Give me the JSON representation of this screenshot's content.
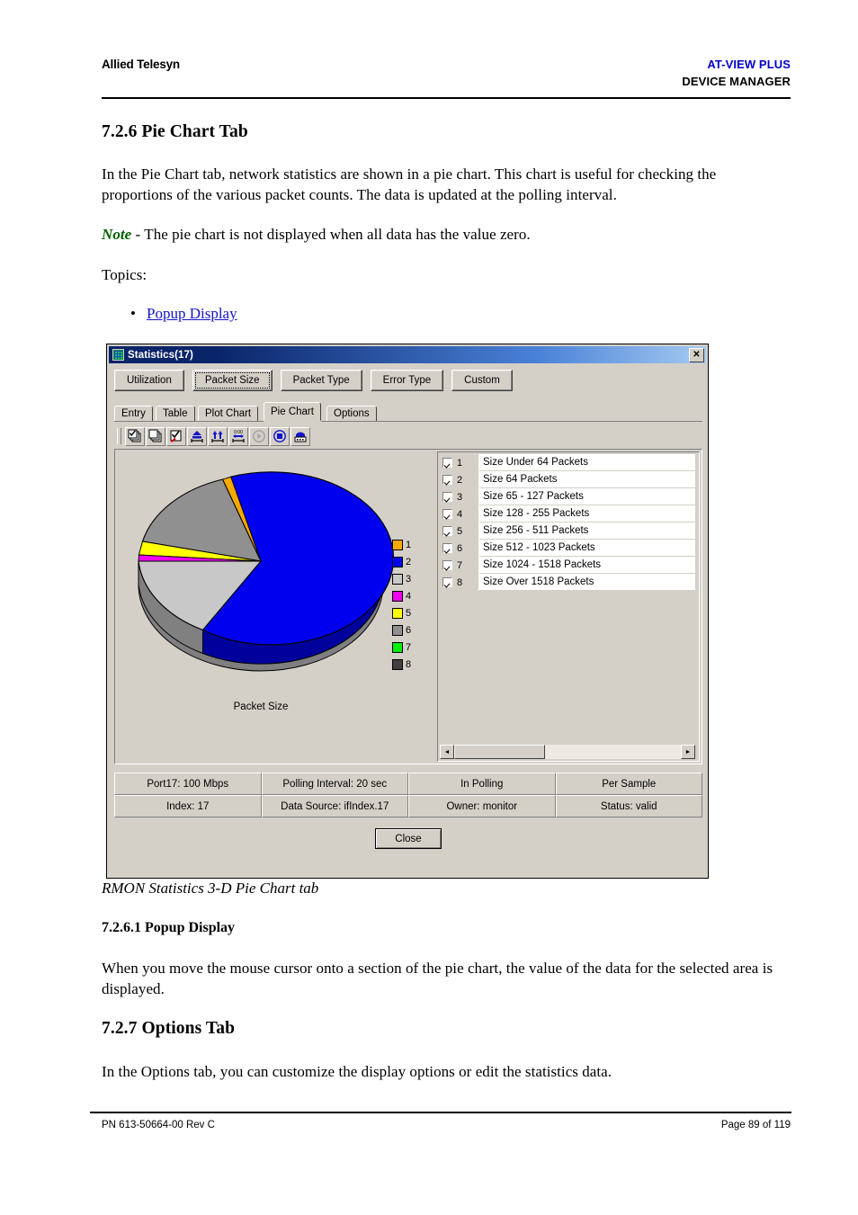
{
  "header": {
    "left": "Allied Telesyn",
    "right_line1": "AT-VIEW PLUS",
    "right_line2": "DEVICE MANAGER"
  },
  "content": {
    "section_heading": "7.2.6 Pie Chart Tab",
    "intro": "In the Pie Chart tab, network statistics are shown in a pie chart. This chart is useful for checking the proportions of the various packet counts. The data is updated at the polling interval.",
    "note_label": "Note",
    "note_text": " - The pie chart is not displayed when all data has the value zero.",
    "topics_label": "Topics:",
    "bullet_char": "•",
    "topic_link": "Popup Display",
    "figure_caption": "RMON Statistics 3-D Pie Chart tab",
    "subsection_heading": "7.2.6.1 Popup Display",
    "popup_text": "When you move the mouse cursor onto a section of the pie chart, the value of the data for the selected area is displayed.",
    "options_heading": "7.2.7 Options Tab",
    "options_text": "In the Options tab, you can customize the display options or edit the statistics data."
  },
  "footer": {
    "left": "PN 613-50664-00 Rev C",
    "right": "Page 89 of 119"
  },
  "dialog": {
    "title": "Statistics(17)",
    "title_icon": "grid-icon",
    "close_glyph": "✕",
    "category_buttons": [
      {
        "label": "Utilization",
        "selected": false
      },
      {
        "label": "Packet Size",
        "selected": true
      },
      {
        "label": "Packet Type",
        "selected": false
      },
      {
        "label": "Error Type",
        "selected": false
      },
      {
        "label": "Custom",
        "selected": false
      }
    ],
    "tabs": [
      {
        "label": "Entry",
        "active": false
      },
      {
        "label": "Table",
        "active": false
      },
      {
        "label": "Plot Chart",
        "active": false
      },
      {
        "label": "Pie Chart",
        "active": true
      },
      {
        "label": "Options",
        "active": false
      }
    ],
    "toolbar": [
      {
        "name": "select-all-layers-icon",
        "enabled": true
      },
      {
        "name": "clear-layers-icon",
        "enabled": true
      },
      {
        "name": "apply-check-icon",
        "enabled": true
      },
      {
        "name": "fit-width-icon",
        "enabled": true
      },
      {
        "name": "scale-vertical-icon",
        "enabled": true
      },
      {
        "name": "time-axis-icon",
        "enabled": true
      },
      {
        "name": "play-icon",
        "enabled": false
      },
      {
        "name": "stop-icon",
        "enabled": true
      },
      {
        "name": "save-print-icon",
        "enabled": true
      }
    ],
    "list": {
      "rows": [
        {
          "index": "1",
          "label": "Size Under 64 Packets",
          "checked": true
        },
        {
          "index": "2",
          "label": "Size 64 Packets",
          "checked": true
        },
        {
          "index": "3",
          "label": "Size 65 - 127 Packets",
          "checked": true
        },
        {
          "index": "4",
          "label": "Size 128 - 255 Packets",
          "checked": true
        },
        {
          "index": "5",
          "label": "Size 256 - 511 Packets",
          "checked": true
        },
        {
          "index": "6",
          "label": "Size 512 - 1023 Packets",
          "checked": true
        },
        {
          "index": "7",
          "label": "Size 1024 - 1518 Packets",
          "checked": true
        },
        {
          "index": "8",
          "label": "Size Over 1518 Packets",
          "checked": true
        }
      ],
      "scroll_left_glyph": "◄",
      "scroll_right_glyph": "►"
    },
    "status_cells": [
      "Port17: 100 Mbps",
      "Polling Interval: 20 sec",
      "In Polling",
      "Per Sample",
      "Index: 17",
      "Data Source: ifIndex.17",
      "Owner: monitor",
      "Status: valid"
    ],
    "close_label": "Close"
  },
  "chart_data": {
    "type": "pie",
    "title": "Packet Size",
    "xlabel": "",
    "ylabel": "",
    "legend_position": "right",
    "three_d": true,
    "categories": [
      "Size Under 64 Packets",
      "Size 64 Packets",
      "Size 65 - 127 Packets",
      "Size 128 - 255 Packets",
      "Size 256 - 511 Packets",
      "Size 512 - 1023 Packets",
      "Size 1024 - 1518 Packets",
      "Size Over 1518 Packets"
    ],
    "legend_labels": [
      "1",
      "2",
      "3",
      "4",
      "5",
      "6",
      "7",
      "8"
    ],
    "colors": [
      "#f5a800",
      "#0000ee",
      "#c8c8c8",
      "#ee00ee",
      "#ffff00",
      "#909090",
      "#00ee00",
      "#404040"
    ],
    "values": [
      0.6,
      71.5,
      19.5,
      0.5,
      2.6,
      5.3,
      0,
      0
    ],
    "units": "percent"
  }
}
